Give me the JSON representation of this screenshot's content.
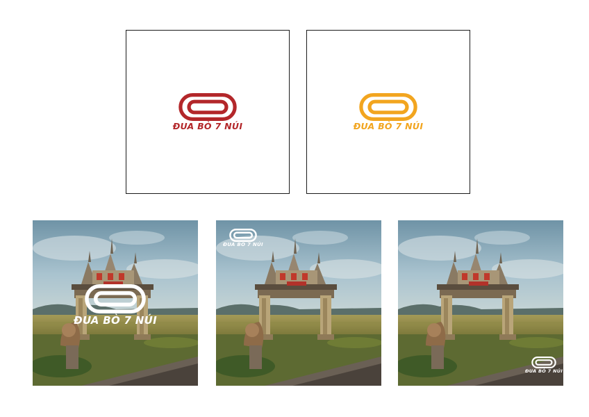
{
  "brand": {
    "name": "ĐUA BÒ 7 NÚI",
    "colors": {
      "primary": "#b3272a",
      "secondary": "#f2a51f",
      "inverse": "#ffffff"
    }
  },
  "panels": [
    {
      "kind": "logo-on-white",
      "logo_color": "#b3272a"
    },
    {
      "kind": "logo-on-white",
      "logo_color": "#f2a51f"
    }
  ],
  "photos": [
    {
      "subject": "temple-gate-photo",
      "logo_placement": "center",
      "logo_color": "#ffffff"
    },
    {
      "subject": "temple-gate-photo",
      "logo_placement": "top-left",
      "logo_color": "#ffffff"
    },
    {
      "subject": "temple-gate-photo",
      "logo_placement": "bottom-right",
      "logo_color": "#ffffff"
    }
  ]
}
